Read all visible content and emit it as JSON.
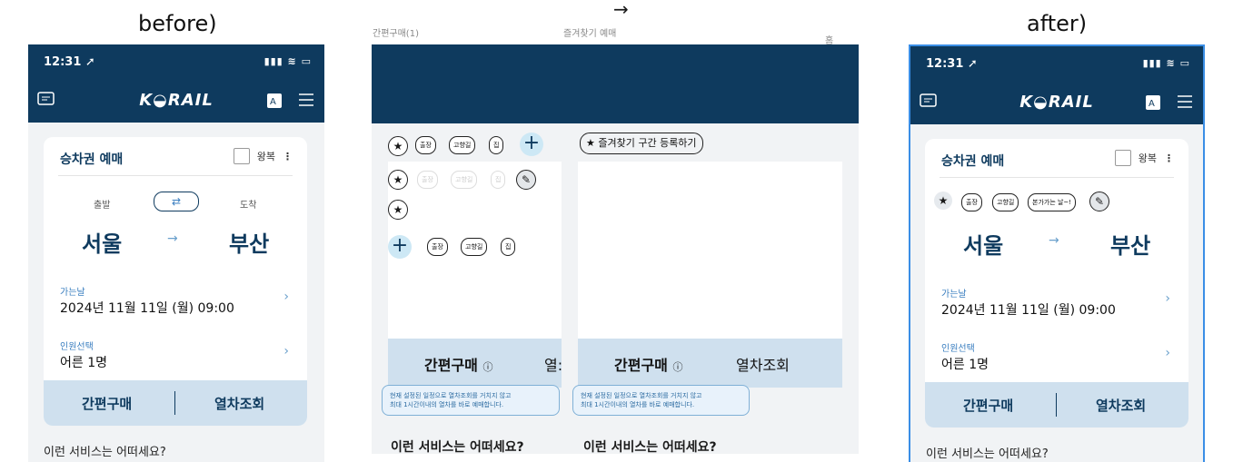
{
  "labels": {
    "before": "before)",
    "after": "after)",
    "arrow": "→"
  },
  "middle": {
    "top_left": "간편구매(1)",
    "top_center": "즐겨찾기 예매",
    "top_right": "홈",
    "add_fav": "즐겨찾기 구간 등록하기",
    "chips": [
      "출장",
      "고향길",
      "집"
    ],
    "quick": "간편구매",
    "lookup": "열차조회",
    "lookup_cut": "열:",
    "tip_line1": "현재 설정된 일정으로 열차조회를 거치지 않고",
    "tip_line2": "최대 1시간이내의 열차를 바로 예매합니다.",
    "service": "이런 서비스는 어떠세요?"
  },
  "phone": {
    "time": "12:31 ➚",
    "signal": "▮▮▮ ≋ ▭",
    "logo": "K◒RAIL",
    "title": "승차권 예매",
    "round": "왕복",
    "depart_label": "출발",
    "arrive_label": "도착",
    "from": "서울",
    "to": "부산",
    "date_label": "가는날",
    "date_value": "2024년 11월 11일 (월) 09:00",
    "people_label": "인원선택",
    "people_value": "어른 1명",
    "quick_buy": "간편구매",
    "train_lookup": "열차조회",
    "service": "이런 서비스는 어떠세요?",
    "fav_chips": [
      "출장",
      "고향길",
      "본가가는 날~!"
    ]
  },
  "colors": {
    "navy": "#0e3a5e",
    "accent": "#6aa0cc",
    "bar": "#cfe0ee"
  }
}
